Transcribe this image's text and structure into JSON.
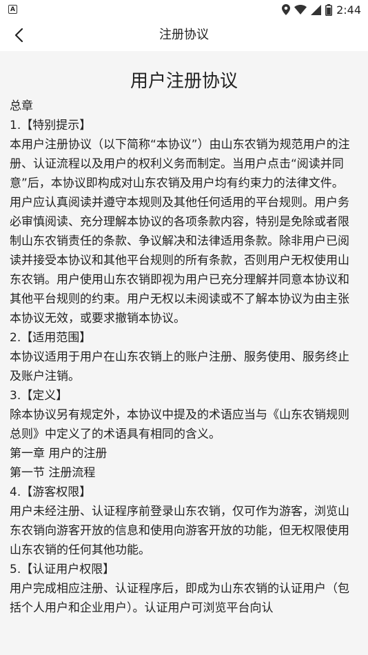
{
  "status_bar": {
    "time": "2:44"
  },
  "nav": {
    "title": "注册协议"
  },
  "document": {
    "title": "用户注册协议",
    "paragraphs": [
      "总章",
      "1.【特别提示】",
      "本用户注册协议（以下简称“本协议”）由山东农销为规范用户的注册、认证流程以及用户的权利义务而制定。当用户点击“阅读并同意”后，本协议即构成对山东农销及用户均有约束力的法律文件。",
      "用户应认真阅读并遵守本规则及其他任何适用的平台规则。用户务必审慎阅读、充分理解本协议的各项条款内容，特别是免除或者限制山东农销责任的条款、争议解决和法律适用条款。除非用户已阅读并接受本协议和其他平台规则的所有条款，否则用户无权使用山东农销。用户使用山东农销即视为用户已充分理解并同意本协议和其他平台规则的约束。用户无权以未阅读或不了解本协议为由主张本协议无效，或要求撤销本协议。",
      "2.【适用范围】",
      "本协议适用于用户在山东农销上的账户注册、服务使用、服务终止及账户注销。",
      "3.【定义】",
      "除本协议另有规定外，本协议中提及的术语应当与《山东农销规则总则》中定义了的术语具有相同的含义。",
      "第一章 用户的注册",
      "第一节 注册流程",
      "4.【游客权限】",
      "用户未经注册、认证程序前登录山东农销，仅可作为游客，浏览山东农销向游客开放的信息和使用向游客开放的功能，但无权限使用山东农销的任何其他功能。",
      "5.【认证用户权限】",
      "用户完成相应注册、认证程序后，即成为山东农销的认证用户（包括个人用户和企业用户）。认证用户可浏览平台向认"
    ]
  }
}
